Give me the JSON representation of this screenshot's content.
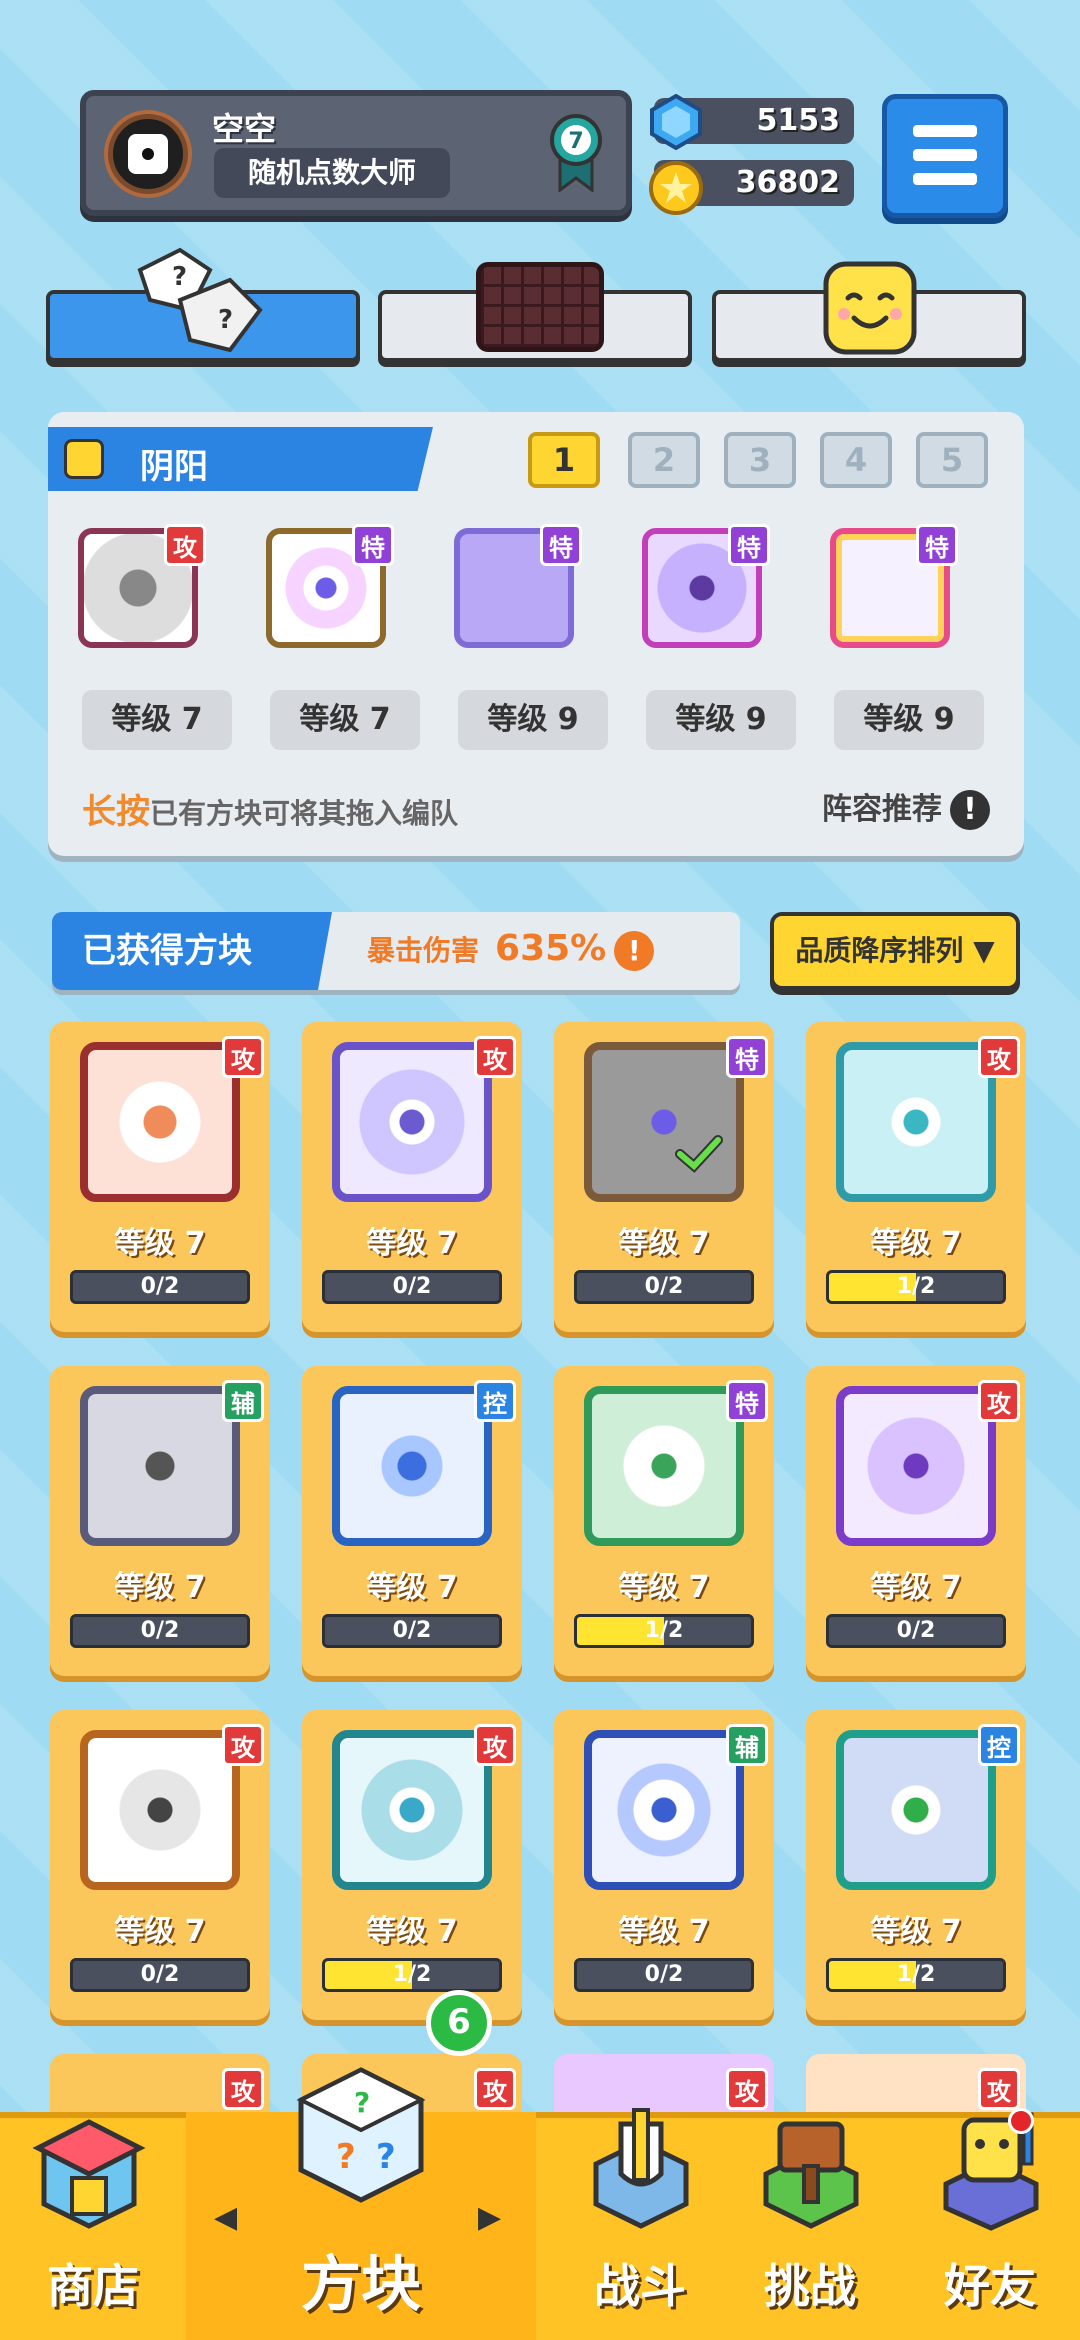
{
  "player": {
    "name": "空空",
    "title": "随机点数大师",
    "rank_level": "7"
  },
  "currency": {
    "gems": "5153",
    "coins": "36802"
  },
  "deck": {
    "name": "阴阳",
    "slots": [
      "1",
      "2",
      "3",
      "4",
      "5"
    ],
    "active_slot": "1",
    "cards": [
      {
        "badge": "攻",
        "level": "等级 7"
      },
      {
        "badge": "特",
        "level": "等级 7"
      },
      {
        "badge": "特",
        "level": "等级 9"
      },
      {
        "badge": "特",
        "level": "等级 9"
      },
      {
        "badge": "特",
        "level": "等级 9"
      }
    ],
    "hint_prefix": "长按",
    "hint_text": "已有方块可将其拖入编队",
    "recommend": "阵容推荐",
    "recommend_icon": "!"
  },
  "obtained": {
    "label": "已获得方块",
    "crit_label": "暴击伤害",
    "crit_value": "635%",
    "crit_icon": "!",
    "sort_label": "品质降序排列 ▼"
  },
  "grid": [
    {
      "badge": "攻",
      "level": "等级 7",
      "progress": "0/2"
    },
    {
      "badge": "攻",
      "level": "等级 7",
      "progress": "0/2"
    },
    {
      "badge": "特",
      "level": "等级 7",
      "progress": "0/2"
    },
    {
      "badge": "攻",
      "level": "等级 7",
      "progress": "1/2"
    },
    {
      "badge": "辅",
      "level": "等级 7",
      "progress": "0/2"
    },
    {
      "badge": "控",
      "level": "等级 7",
      "progress": "0/2"
    },
    {
      "badge": "特",
      "level": "等级 7",
      "progress": "1/2"
    },
    {
      "badge": "攻",
      "level": "等级 7",
      "progress": "0/2"
    },
    {
      "badge": "攻",
      "level": "等级 7",
      "progress": "0/2"
    },
    {
      "badge": "攻",
      "level": "等级 7",
      "progress": "1/2"
    },
    {
      "badge": "辅",
      "level": "等级 7",
      "progress": "0/2"
    },
    {
      "badge": "控",
      "level": "等级 7",
      "progress": "1/2"
    }
  ],
  "partial_row_badges": [
    "攻",
    "攻",
    "攻",
    "攻"
  ],
  "nav": {
    "shop": "商店",
    "blocks": "方块",
    "battle": "战斗",
    "challenge": "挑战",
    "friends": "好友",
    "blocks_badge": "6",
    "arrow_left": "◀",
    "arrow_right": "▶"
  }
}
